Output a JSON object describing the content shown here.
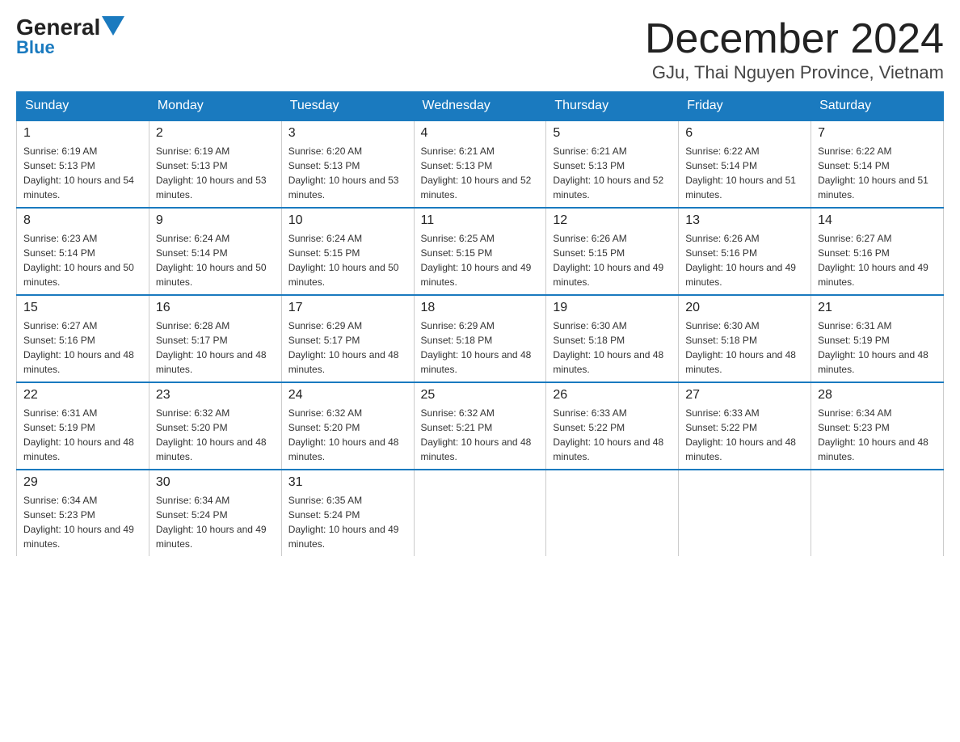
{
  "logo": {
    "general": "General",
    "blue": "Blue"
  },
  "title": "December 2024",
  "location": "GJu, Thai Nguyen Province, Vietnam",
  "days_header": [
    "Sunday",
    "Monday",
    "Tuesday",
    "Wednesday",
    "Thursday",
    "Friday",
    "Saturday"
  ],
  "weeks": [
    [
      {
        "day": "1",
        "sunrise": "6:19 AM",
        "sunset": "5:13 PM",
        "daylight": "10 hours and 54 minutes."
      },
      {
        "day": "2",
        "sunrise": "6:19 AM",
        "sunset": "5:13 PM",
        "daylight": "10 hours and 53 minutes."
      },
      {
        "day": "3",
        "sunrise": "6:20 AM",
        "sunset": "5:13 PM",
        "daylight": "10 hours and 53 minutes."
      },
      {
        "day": "4",
        "sunrise": "6:21 AM",
        "sunset": "5:13 PM",
        "daylight": "10 hours and 52 minutes."
      },
      {
        "day": "5",
        "sunrise": "6:21 AM",
        "sunset": "5:13 PM",
        "daylight": "10 hours and 52 minutes."
      },
      {
        "day": "6",
        "sunrise": "6:22 AM",
        "sunset": "5:14 PM",
        "daylight": "10 hours and 51 minutes."
      },
      {
        "day": "7",
        "sunrise": "6:22 AM",
        "sunset": "5:14 PM",
        "daylight": "10 hours and 51 minutes."
      }
    ],
    [
      {
        "day": "8",
        "sunrise": "6:23 AM",
        "sunset": "5:14 PM",
        "daylight": "10 hours and 50 minutes."
      },
      {
        "day": "9",
        "sunrise": "6:24 AM",
        "sunset": "5:14 PM",
        "daylight": "10 hours and 50 minutes."
      },
      {
        "day": "10",
        "sunrise": "6:24 AM",
        "sunset": "5:15 PM",
        "daylight": "10 hours and 50 minutes."
      },
      {
        "day": "11",
        "sunrise": "6:25 AM",
        "sunset": "5:15 PM",
        "daylight": "10 hours and 49 minutes."
      },
      {
        "day": "12",
        "sunrise": "6:26 AM",
        "sunset": "5:15 PM",
        "daylight": "10 hours and 49 minutes."
      },
      {
        "day": "13",
        "sunrise": "6:26 AM",
        "sunset": "5:16 PM",
        "daylight": "10 hours and 49 minutes."
      },
      {
        "day": "14",
        "sunrise": "6:27 AM",
        "sunset": "5:16 PM",
        "daylight": "10 hours and 49 minutes."
      }
    ],
    [
      {
        "day": "15",
        "sunrise": "6:27 AM",
        "sunset": "5:16 PM",
        "daylight": "10 hours and 48 minutes."
      },
      {
        "day": "16",
        "sunrise": "6:28 AM",
        "sunset": "5:17 PM",
        "daylight": "10 hours and 48 minutes."
      },
      {
        "day": "17",
        "sunrise": "6:29 AM",
        "sunset": "5:17 PM",
        "daylight": "10 hours and 48 minutes."
      },
      {
        "day": "18",
        "sunrise": "6:29 AM",
        "sunset": "5:18 PM",
        "daylight": "10 hours and 48 minutes."
      },
      {
        "day": "19",
        "sunrise": "6:30 AM",
        "sunset": "5:18 PM",
        "daylight": "10 hours and 48 minutes."
      },
      {
        "day": "20",
        "sunrise": "6:30 AM",
        "sunset": "5:18 PM",
        "daylight": "10 hours and 48 minutes."
      },
      {
        "day": "21",
        "sunrise": "6:31 AM",
        "sunset": "5:19 PM",
        "daylight": "10 hours and 48 minutes."
      }
    ],
    [
      {
        "day": "22",
        "sunrise": "6:31 AM",
        "sunset": "5:19 PM",
        "daylight": "10 hours and 48 minutes."
      },
      {
        "day": "23",
        "sunrise": "6:32 AM",
        "sunset": "5:20 PM",
        "daylight": "10 hours and 48 minutes."
      },
      {
        "day": "24",
        "sunrise": "6:32 AM",
        "sunset": "5:20 PM",
        "daylight": "10 hours and 48 minutes."
      },
      {
        "day": "25",
        "sunrise": "6:32 AM",
        "sunset": "5:21 PM",
        "daylight": "10 hours and 48 minutes."
      },
      {
        "day": "26",
        "sunrise": "6:33 AM",
        "sunset": "5:22 PM",
        "daylight": "10 hours and 48 minutes."
      },
      {
        "day": "27",
        "sunrise": "6:33 AM",
        "sunset": "5:22 PM",
        "daylight": "10 hours and 48 minutes."
      },
      {
        "day": "28",
        "sunrise": "6:34 AM",
        "sunset": "5:23 PM",
        "daylight": "10 hours and 48 minutes."
      }
    ],
    [
      {
        "day": "29",
        "sunrise": "6:34 AM",
        "sunset": "5:23 PM",
        "daylight": "10 hours and 49 minutes."
      },
      {
        "day": "30",
        "sunrise": "6:34 AM",
        "sunset": "5:24 PM",
        "daylight": "10 hours and 49 minutes."
      },
      {
        "day": "31",
        "sunrise": "6:35 AM",
        "sunset": "5:24 PM",
        "daylight": "10 hours and 49 minutes."
      },
      null,
      null,
      null,
      null
    ]
  ]
}
